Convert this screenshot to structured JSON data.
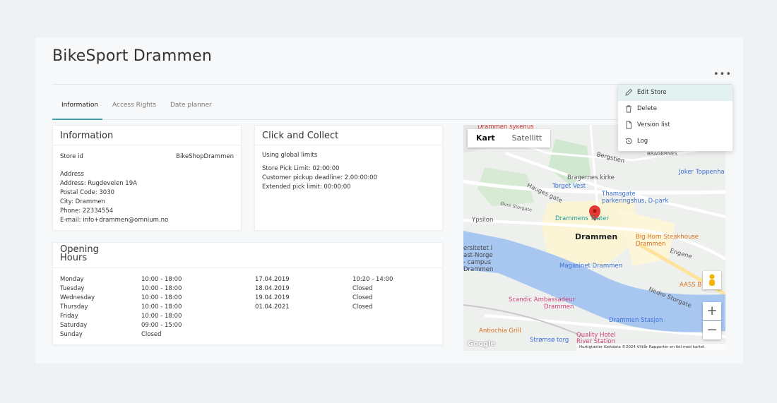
{
  "page_title": "BikeSport Drammen",
  "more_menu_label": "•••",
  "tabs": [
    {
      "label": "Information"
    },
    {
      "label": "Access Rights"
    },
    {
      "label": "Date planner"
    }
  ],
  "info_card": {
    "title": "Information",
    "store_id_label": "Store id",
    "store_id_value": "BikeShopDrammen",
    "address_heading": "Address",
    "address_lines": [
      "Address: Rugdeveien 19A",
      "Postal Code: 3030",
      "City: Drammen",
      "Phone: 22334554",
      "E-mail: info+drammen@omnium.no"
    ]
  },
  "click_collect": {
    "title": "Click and Collect",
    "subtitle": "Using global limits",
    "lines": [
      "Store Pick Limit: 02:00:00",
      "Customer pickup deadline: 2.00:00:00",
      "Extended pick limit: 00:00:00"
    ]
  },
  "opening_hours": {
    "title_line1": "Opening",
    "title_line2": "Hours",
    "weekly": [
      {
        "day": "Monday",
        "hours": "10:00 - 18:00"
      },
      {
        "day": "Tuesday",
        "hours": "10:00 - 18:00"
      },
      {
        "day": "Wednesday",
        "hours": "10:00 - 18:00"
      },
      {
        "day": "Thursday",
        "hours": "10:00 - 18:00"
      },
      {
        "day": "Friday",
        "hours": "10:00 - 18:00"
      },
      {
        "day": "Saturday",
        "hours": "09:00 - 15:00"
      },
      {
        "day": "Sunday",
        "hours": "Closed"
      }
    ],
    "special": [
      {
        "date": "17.04.2019",
        "hours": "10:20 - 14:00"
      },
      {
        "date": "18.04.2019",
        "hours": "Closed"
      },
      {
        "date": "19.04.2019",
        "hours": "Closed"
      },
      {
        "date": "01.04.2021",
        "hours": "Closed"
      }
    ]
  },
  "map": {
    "tab_map": "Kart",
    "tab_satellite": "Satellitt",
    "zoom_in": "+",
    "zoom_out": "−",
    "logo": "Google",
    "attribution": "Hurtigtaster   Kartdata ©2024   Vilkår   Rapportér en feil med kartet",
    "labels": {
      "sykehus": "Drammen sykehus",
      "bergstien": "Bergstien",
      "bragernes": "BRAGERNES",
      "bragernes_kirke": "Bragernes kirke",
      "joker": "Joker Toppenha",
      "torget": "Torget Vest",
      "thamsgate": "Thamsgate",
      "parkeringshus": "parkeringshus, D-park",
      "teater": "Drammens Teater",
      "ypsilon": "Ypsilon",
      "drammen": "Drammen",
      "bighorn": "Big Horn Steakhouse",
      "bighorn2": "Drammen",
      "universitetet1": "ersitetet i",
      "universitetet2": "ast-Norge",
      "universitetet3": "- campus",
      "universitetet4": "Drammen",
      "magasinet": "Magasinet Drammen",
      "aass": "AASS B",
      "scandic1": "Scandic Ambassadeur",
      "scandic2": "Drammen",
      "stasjon": "Drammen Stasjon",
      "antiochia": "Antiochia Grill",
      "quality1": "Quality Hotel",
      "quality2": "River Station",
      "stromso": "Strømsø torg",
      "ovre": "Øvre Storgate",
      "engene": "Engene",
      "nedre": "Nedre Storgate",
      "hauges": "Hauges gate"
    }
  },
  "context_menu": {
    "items": [
      {
        "label": "Edit Store",
        "icon": "pencil-icon"
      },
      {
        "label": "Delete",
        "icon": "trash-icon"
      },
      {
        "label": "Version list",
        "icon": "document-icon"
      },
      {
        "label": "Log",
        "icon": "history-icon"
      }
    ]
  },
  "colors": {
    "accent": "#3f9fa6",
    "menu_highlight": "#e3f1f1",
    "river": "#a8c7f0",
    "map_pin": "#e53935"
  }
}
